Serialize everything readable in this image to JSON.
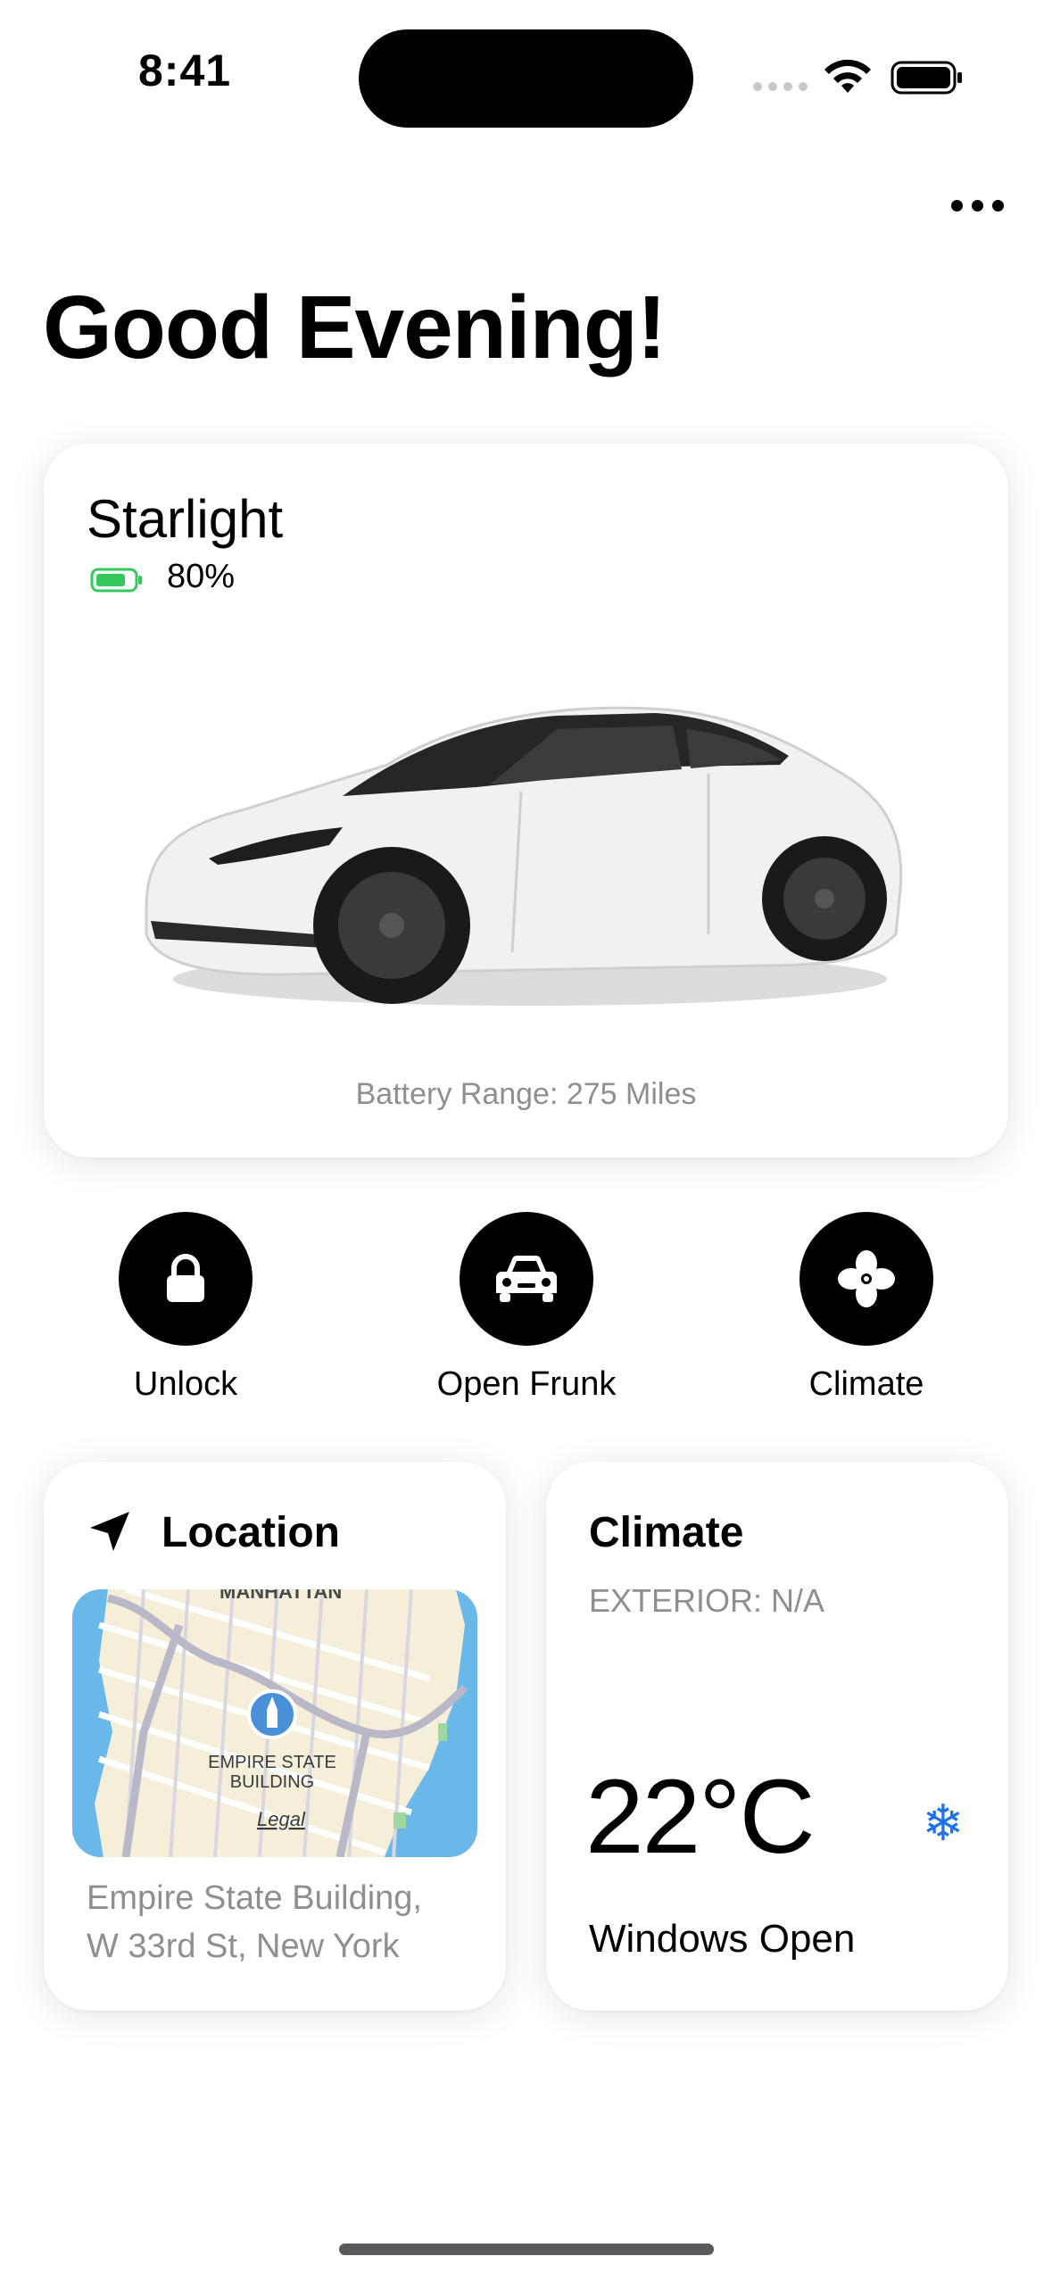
{
  "status_bar": {
    "time": "8:41"
  },
  "header": {
    "greeting": "Good Evening!"
  },
  "vehicle": {
    "name": "Starlight",
    "battery_percent": "80%",
    "battery_level": 0.8,
    "battery_range": "Battery Range: 275 Miles",
    "battery_color": "#34c759"
  },
  "actions": [
    {
      "label": "Unlock",
      "icon": "lock-icon"
    },
    {
      "label": "Open Frunk",
      "icon": "car-icon"
    },
    {
      "label": "Climate",
      "icon": "fan-icon"
    }
  ],
  "location": {
    "title": "Location",
    "map_label_top": "MANHATTAN",
    "map_poi": "EMPIRE STATE\nBUILDING",
    "map_legal": "Legal",
    "address_line1": "Empire State Building,",
    "address_line2": "W 33rd St, New York"
  },
  "climate": {
    "title": "Climate",
    "exterior": "EXTERIOR: N/A",
    "temperature": "22°C",
    "status": "Windows Open",
    "mode_icon": "snowflake-icon",
    "mode_color": "#1a73e8"
  }
}
